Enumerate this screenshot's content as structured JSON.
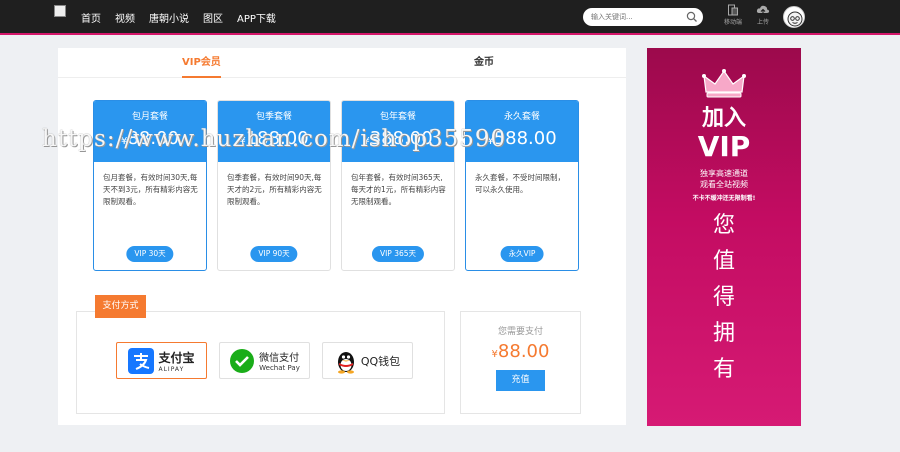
{
  "nav": {
    "items": [
      "首页",
      "视频",
      "唐朝小说",
      "图区",
      "APP下载"
    ]
  },
  "search": {
    "placeholder": "输入关键词..."
  },
  "tools": {
    "mobile_label": "移动端",
    "upload_label": "上传"
  },
  "tabs": [
    {
      "label": "VIP会员",
      "active": true
    },
    {
      "label": "金币",
      "active": false
    }
  ],
  "plans": [
    {
      "name": "包月套餐",
      "currency": "¥",
      "price": "88.00",
      "desc": "包月套餐，有效时间30天,每天不到3元，所有精彩内容无限制观看。",
      "button": "VIP 30天"
    },
    {
      "name": "包季套餐",
      "currency": "¥",
      "price": "188.00",
      "desc": "包季套餐，有效时间90天,每天才的2元，所有精彩内容无限制观看。",
      "button": "VIP 90天"
    },
    {
      "name": "包年套餐",
      "currency": "¥",
      "price": "388.00",
      "desc": "包年套餐，有效时间365天,每天才的1元，所有精彩内容无限制观看。",
      "button": "VIP 365天"
    },
    {
      "name": "永久套餐",
      "currency": "¥",
      "price": "588.00",
      "desc": "永久套餐，不受时间限制，可以永久使用。",
      "button": "永久VIP"
    }
  ],
  "payment": {
    "label": "支付方式",
    "methods": [
      {
        "name": "支付宝",
        "sub": "ALIPAY"
      },
      {
        "name": "微信支付",
        "sub": "Wechat Pay"
      },
      {
        "name": "QQ钱包",
        "sub": ""
      }
    ]
  },
  "total": {
    "label": "您需要支付",
    "currency": "¥",
    "amount": "88.00",
    "button": "充值"
  },
  "ad": {
    "join_line1": "加入",
    "join_line2": "VIP",
    "sub_line1": "独享高速通道",
    "sub_line2": "观看全站视频",
    "sub_line3": "不卡不缓冲还无限制看!",
    "big_text": [
      "您",
      "值",
      "得",
      "拥",
      "有"
    ]
  },
  "watermark": "https://www.huzhan.com/ishop35590",
  "colors": {
    "accent": "#f57a30",
    "primary": "#2a96ef",
    "nav_bg": "#1f1f1f",
    "ad": "#c30c62"
  }
}
